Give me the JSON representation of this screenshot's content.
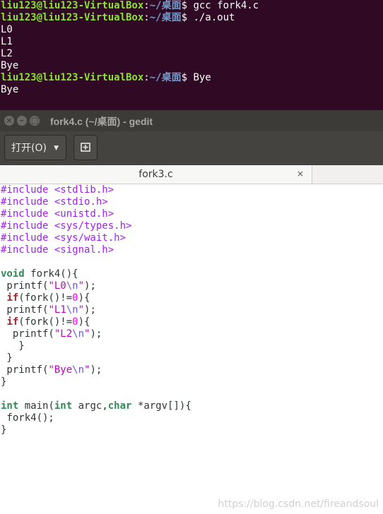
{
  "terminal": {
    "lines": [
      {
        "user": "liu123@liu123-VirtualBox",
        "sep": ":",
        "path": "~/桌面",
        "prompt": "$ ",
        "text": "gcc fork4.c"
      },
      {
        "user": "liu123@liu123-VirtualBox",
        "sep": ":",
        "path": "~/桌面",
        "prompt": "$ ",
        "text": "./a.out"
      },
      {
        "text": "L0"
      },
      {
        "text": "L1"
      },
      {
        "text": "L2"
      },
      {
        "text": "Bye"
      },
      {
        "user": "liu123@liu123-VirtualBox",
        "sep": ":",
        "path": "~/桌面",
        "prompt": "$ ",
        "text": "Bye"
      },
      {
        "text": "Bye"
      }
    ]
  },
  "window": {
    "title": "fork4.c (~/桌面) - gedit",
    "close_glyph": "×",
    "minimize_glyph": "–",
    "maximize_glyph": "□"
  },
  "toolbar": {
    "open_label": "打开(O)",
    "open_arrow": "▼",
    "new_icon": "new-document-icon"
  },
  "tab": {
    "label": "fork3.c",
    "close": "×"
  },
  "code": {
    "lines": [
      [
        {
          "t": "#include <stdlib.h>",
          "c": "c-pre"
        }
      ],
      [
        {
          "t": "#include <stdio.h>",
          "c": "c-pre"
        }
      ],
      [
        {
          "t": "#include <unistd.h>",
          "c": "c-pre"
        }
      ],
      [
        {
          "t": "#include <sys/types.h>",
          "c": "c-pre"
        }
      ],
      [
        {
          "t": "#include <sys/wait.h>",
          "c": "c-pre"
        }
      ],
      [
        {
          "t": "#include <signal.h>",
          "c": "c-pre"
        }
      ],
      [],
      [
        {
          "t": "void",
          "c": "c-ty"
        },
        {
          "t": " fork4(){"
        }
      ],
      [
        {
          "t": " printf("
        },
        {
          "t": "\"L0",
          "c": "c-str"
        },
        {
          "t": "\\n",
          "c": "c-esc"
        },
        {
          "t": "\"",
          "c": "c-str"
        },
        {
          "t": ");"
        }
      ],
      [
        {
          "t": " "
        },
        {
          "t": "if",
          "c": "c-kw"
        },
        {
          "t": "(fork()!="
        },
        {
          "t": "0",
          "c": "c-num"
        },
        {
          "t": "){"
        }
      ],
      [
        {
          "t": " printf("
        },
        {
          "t": "\"L1",
          "c": "c-str"
        },
        {
          "t": "\\n",
          "c": "c-esc"
        },
        {
          "t": "\"",
          "c": "c-str"
        },
        {
          "t": ");"
        }
      ],
      [
        {
          "t": " "
        },
        {
          "t": "if",
          "c": "c-kw"
        },
        {
          "t": "(fork()!="
        },
        {
          "t": "0",
          "c": "c-num"
        },
        {
          "t": "){"
        }
      ],
      [
        {
          "t": "  printf("
        },
        {
          "t": "\"L2",
          "c": "c-str"
        },
        {
          "t": "\\n",
          "c": "c-esc"
        },
        {
          "t": "\"",
          "c": "c-str"
        },
        {
          "t": ");"
        }
      ],
      [
        {
          "t": "   }"
        }
      ],
      [
        {
          "t": " }"
        }
      ],
      [
        {
          "t": " printf("
        },
        {
          "t": "\"Bye",
          "c": "c-str"
        },
        {
          "t": "\\n",
          "c": "c-esc"
        },
        {
          "t": "\"",
          "c": "c-str"
        },
        {
          "t": ");"
        }
      ],
      [
        {
          "t": "}"
        }
      ],
      [],
      [
        {
          "t": "int",
          "c": "c-ty"
        },
        {
          "t": " main("
        },
        {
          "t": "int",
          "c": "c-ty"
        },
        {
          "t": " argc,"
        },
        {
          "t": "char",
          "c": "c-ty"
        },
        {
          "t": " *argv[]){"
        }
      ],
      [
        {
          "t": " fork4();"
        }
      ],
      [
        {
          "t": "}"
        }
      ]
    ]
  },
  "watermark": "https://blog.csdn.net/fireandsoul"
}
